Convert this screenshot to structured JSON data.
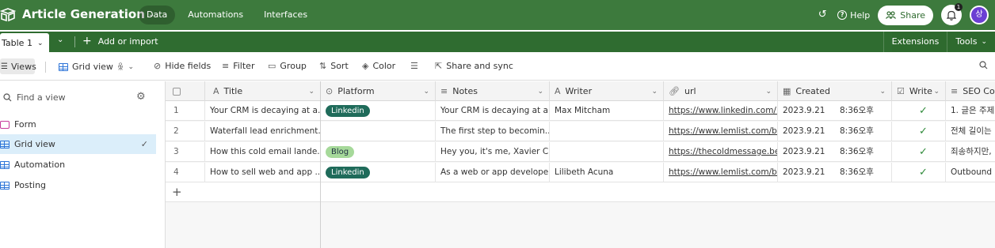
{
  "app": {
    "base_title": "Article Generation",
    "nav": [
      "Data",
      "Automations",
      "Interfaces"
    ],
    "help_label": "Help",
    "share_label": "Share",
    "notification_count": "1",
    "avatar_initial": "상"
  },
  "tablebar": {
    "table_name": "Table 1",
    "add_import": "Add or import",
    "extensions": "Extensions",
    "tools": "Tools"
  },
  "toolbar": {
    "views": "Views",
    "grid_view": "Grid view",
    "hide_fields": "Hide fields",
    "filter": "Filter",
    "group": "Group",
    "sort": "Sort",
    "color": "Color",
    "share_sync": "Share and sync"
  },
  "sidebar": {
    "find_placeholder": "Find a view",
    "items": [
      {
        "label": "Form",
        "icon": "form-icon"
      },
      {
        "label": "Grid view",
        "icon": "grid-icon",
        "active": true
      },
      {
        "label": "Automation",
        "icon": "grid-icon"
      },
      {
        "label": "Posting",
        "icon": "grid-icon"
      }
    ]
  },
  "grid": {
    "columns": [
      "Title",
      "Platform",
      "Notes",
      "Writer",
      "url",
      "Created",
      "Write",
      "SEO Con"
    ],
    "rows": [
      {
        "num": "1",
        "title": "Your CRM is decaying at a...",
        "platform": "Linkedin",
        "platform_style": "dark",
        "notes": "Your CRM is decaying at a...",
        "writer": "Max Mitcham",
        "url": "https://www.linkedin.com/...",
        "date": "2023.9.21",
        "time": "8:36오후",
        "seo": "1. 글은 주제"
      },
      {
        "num": "2",
        "title": "Waterfall lead enrichment...",
        "platform": "",
        "platform_style": "",
        "notes": "The first step to becomin...",
        "writer": "",
        "url": "https://www.lemlist.com/bl...",
        "date": "2023.9.21",
        "time": "8:36오후",
        "seo": "전체 길이는"
      },
      {
        "num": "3",
        "title": "How this cold email lande...",
        "platform": "Blog",
        "platform_style": "light",
        "notes": "Hey you, it's me, Xavier C...",
        "writer": "",
        "url": "https://thecoldmessage.be...",
        "date": "2023.9.21",
        "time": "8:36오후",
        "seo": "죄송하지만,"
      },
      {
        "num": "4",
        "title": "How to sell web and app ...",
        "platform": "Linkedin",
        "platform_style": "dark",
        "notes": "As a web or app develope...",
        "writer": "Lilibeth Acuna",
        "url": "https://www.lemlist.com/bl...",
        "date": "2023.9.21",
        "time": "8:36오후",
        "seo": "Outbound 세"
      }
    ]
  }
}
